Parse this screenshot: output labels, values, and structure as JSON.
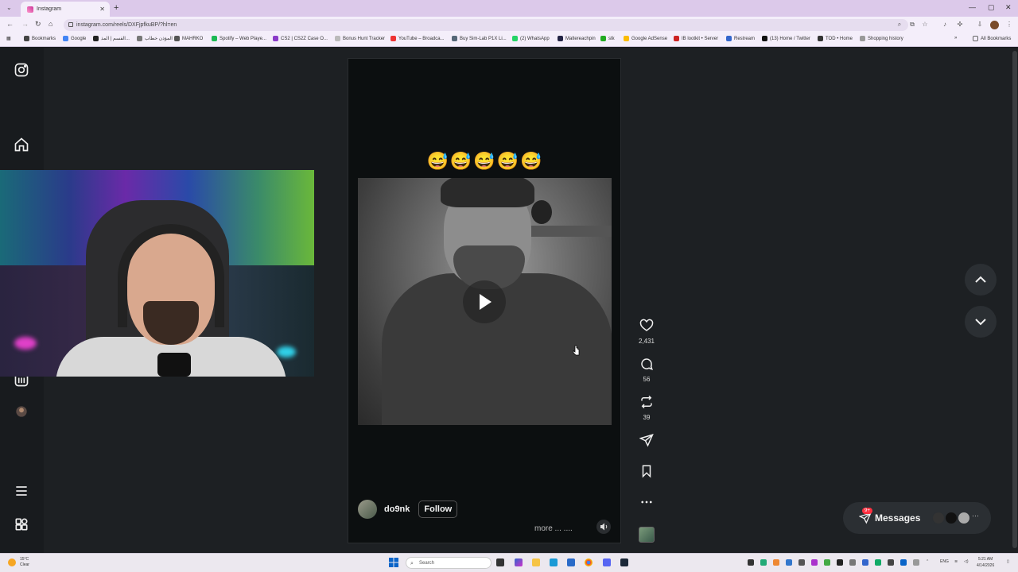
{
  "browser": {
    "tab_title": "Instagram",
    "url": "instagram.com/reels/DXFjpfkuBP/?hl=en",
    "bookmarks": [
      "Bookmarks",
      "Google",
      "القسم | المذ...",
      "المؤذن خطاب",
      "MAHRKO",
      "Spotify – Web Playe...",
      "CS2 | CS2Z Case O...",
      "Bonus Hunt Tracker",
      "YouTube – Broadca...",
      "Buy Sim-Lab P1X Li...",
      "(2) WhatsApp",
      "Maltereachpin",
      "stk",
      "Google AdSense",
      "IB lootkit • Server",
      "Restream",
      "(13) Home / Twitter",
      "TOD • Home",
      "Shopping history"
    ],
    "all_bookmarks": "All Bookmarks"
  },
  "reel": {
    "emoji_caption": "😅😅😅😅😅",
    "username": "do9nk",
    "follow_label": "Follow",
    "more_label": "more ... ....",
    "likes": "2,431",
    "comments": "56",
    "reposts": "39"
  },
  "messages": {
    "label": "Messages",
    "badge": "9+"
  },
  "taskbar": {
    "weather_temp": "15°C",
    "weather_desc": "Clear",
    "search_placeholder": "Search",
    "lang": "ENG",
    "time": "5:21 AM",
    "date": "4/14/2026"
  },
  "colors": {
    "page_bg": "#1d2023",
    "tab_strip": "#dcc9ea",
    "notification": "#ff3040"
  }
}
